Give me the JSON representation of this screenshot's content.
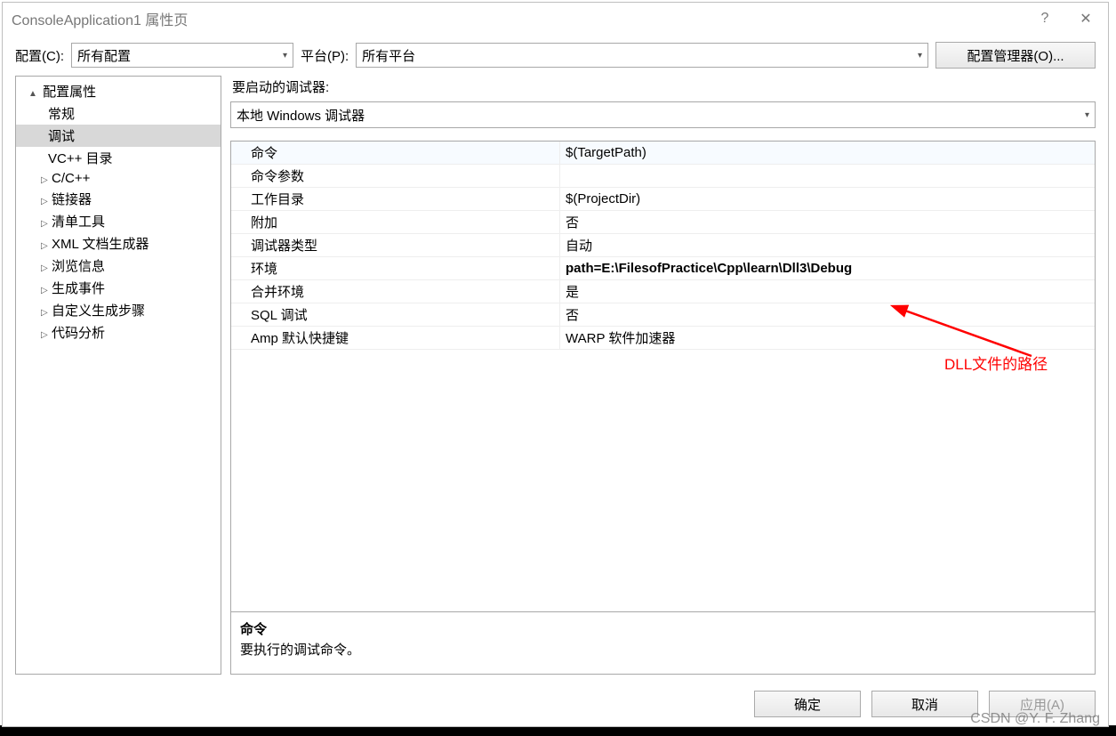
{
  "window": {
    "title": "ConsoleApplication1 属性页",
    "help_icon": "?",
    "close_icon": "✕"
  },
  "toolbar": {
    "config_label": "配置(C):",
    "config_value": "所有配置",
    "platform_label": "平台(P):",
    "platform_value": "所有平台",
    "config_manager": "配置管理器(O)..."
  },
  "tree": {
    "root": "配置属性",
    "items": [
      {
        "label": "常规",
        "expandable": false
      },
      {
        "label": "调试",
        "expandable": false,
        "selected": true
      },
      {
        "label": "VC++ 目录",
        "expandable": false
      },
      {
        "label": "C/C++",
        "expandable": true
      },
      {
        "label": "链接器",
        "expandable": true
      },
      {
        "label": "清单工具",
        "expandable": true
      },
      {
        "label": "XML 文档生成器",
        "expandable": true
      },
      {
        "label": "浏览信息",
        "expandable": true
      },
      {
        "label": "生成事件",
        "expandable": true
      },
      {
        "label": "自定义生成步骤",
        "expandable": true
      },
      {
        "label": "代码分析",
        "expandable": true
      }
    ]
  },
  "debugger": {
    "section_label": "要启动的调试器:",
    "selected": "本地 Windows 调试器"
  },
  "props": [
    {
      "name": "命令",
      "value": "$(TargetPath)"
    },
    {
      "name": "命令参数",
      "value": ""
    },
    {
      "name": "工作目录",
      "value": "$(ProjectDir)"
    },
    {
      "name": "附加",
      "value": "否"
    },
    {
      "name": "调试器类型",
      "value": "自动"
    },
    {
      "name": "环境",
      "value": "path=E:\\FilesofPractice\\Cpp\\learn\\Dll3\\Debug",
      "bold": true
    },
    {
      "name": "合并环境",
      "value": "是"
    },
    {
      "name": "SQL 调试",
      "value": "否"
    },
    {
      "name": "Amp 默认快捷键",
      "value": "WARP 软件加速器"
    }
  ],
  "description": {
    "title": "命令",
    "body": "要执行的调试命令。"
  },
  "buttons": {
    "ok": "确定",
    "cancel": "取消",
    "apply": "应用(A)"
  },
  "annotation": {
    "text": "DLL文件的路径"
  },
  "watermark": "CSDN @Y. F. Zhang"
}
